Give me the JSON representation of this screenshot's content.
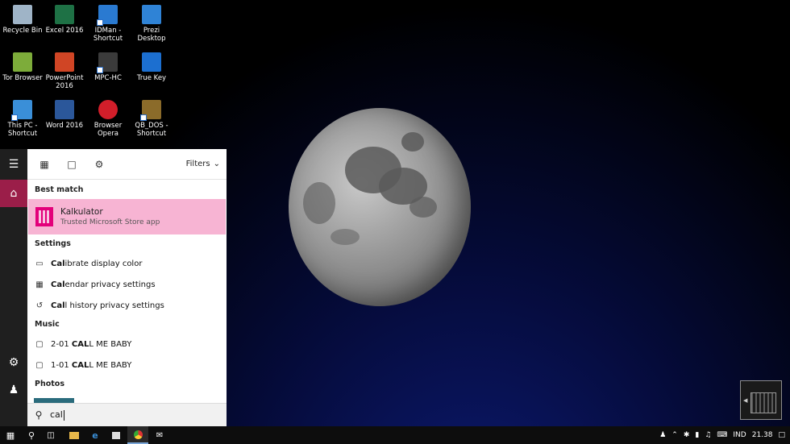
{
  "desktop": {
    "icons": [
      {
        "label": "Recycle Bin",
        "color": "#9fb4c7"
      },
      {
        "label": "Excel 2016",
        "color": "#1e7145"
      },
      {
        "label": "IDMan - Shortcut",
        "color": "#2a7ad1"
      },
      {
        "label": "Prezi Desktop",
        "color": "#2f83d6"
      },
      {
        "label": "Tor Browser",
        "color": "#7dac3a"
      },
      {
        "label": "PowerPoint 2016",
        "color": "#d04525"
      },
      {
        "label": "MPC-HC",
        "color": "#3b3b3b"
      },
      {
        "label": "True Key",
        "color": "#1c6fd0"
      },
      {
        "label": "This PC - Shortcut",
        "color": "#3a8fd8"
      },
      {
        "label": "Word 2016",
        "color": "#2b579a"
      },
      {
        "label": "Browser Opera",
        "color": "#d21e2a"
      },
      {
        "label": "QB_DOS - Shortcut",
        "color": "#8b6b2a"
      }
    ]
  },
  "start": {
    "top_icons": [
      "news-icon",
      "document-icon",
      "settings-icon"
    ],
    "filters_label": "Filters",
    "best_match": {
      "section": "Best match",
      "title": "Kalkulator",
      "subtitle": "Trusted Microsoft Store app",
      "icon_color": "#e3007a"
    },
    "settings": {
      "section": "Settings",
      "items": [
        {
          "bold": "Cal",
          "rest": "ibrate display color",
          "icon": "display-icon"
        },
        {
          "bold": "Cal",
          "rest": "endar privacy settings",
          "icon": "calendar-icon"
        },
        {
          "bold": "Cal",
          "rest": "l history privacy settings",
          "icon": "history-icon"
        }
      ]
    },
    "music": {
      "section": "Music",
      "items": [
        {
          "pre": "2-01 ",
          "bold": "CAL",
          "rest": "L ME BABY"
        },
        {
          "pre": "1-01 ",
          "bold": "CAL",
          "rest": "L ME BABY"
        }
      ]
    },
    "photos": {
      "section": "Photos"
    },
    "search": {
      "query": "cal"
    }
  },
  "taskbar": {
    "language": "IND",
    "time": "21.38"
  },
  "colors": {
    "accent": "#9b1e49",
    "best_match_bg": "#f7b4d3"
  }
}
